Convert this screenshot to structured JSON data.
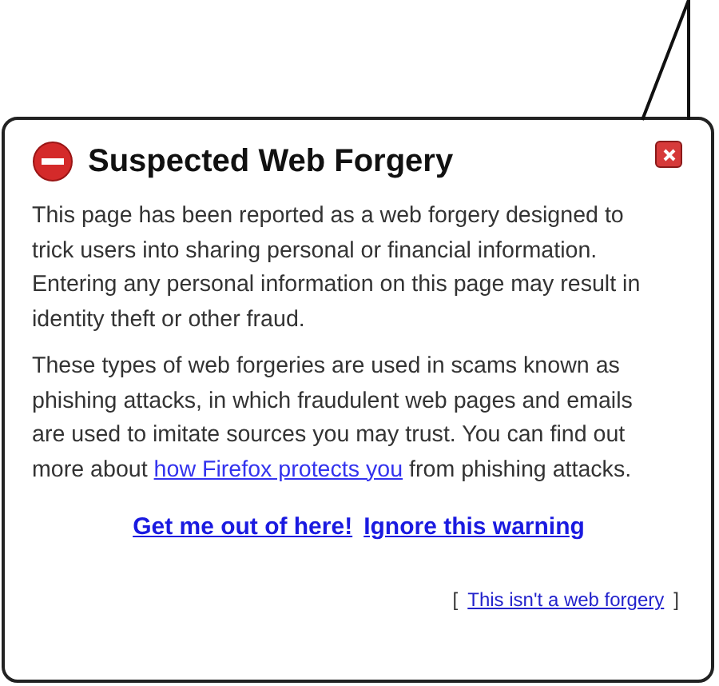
{
  "panel": {
    "title": "Suspected Web Forgery",
    "paragraph_1": "This page has been reported as a web forgery designed to trick users into sharing personal or financial information. Entering any personal information on this page may result in identity theft or other fraud.",
    "paragraph_2": {
      "before": "These types of web forgeries are used in scams known as phishing attacks, in which fraudulent web pages and emails are used to imitate sources you may trust. You can find out more about",
      "link": "how Firefox protects you",
      "after": "from phishing attacks."
    },
    "actions": [
      "Get me out of here!",
      "Ignore this warning"
    ],
    "report": {
      "open_bracket": "[",
      "link": "This isn't a web forgery",
      "close_bracket": "]"
    }
  }
}
